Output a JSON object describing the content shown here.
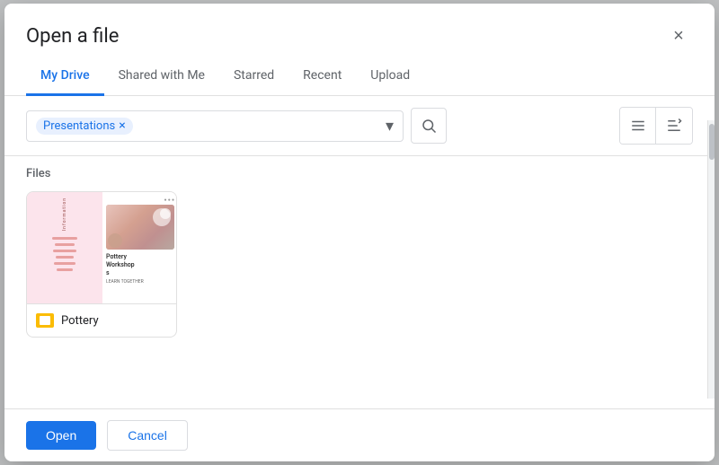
{
  "dialog": {
    "title": "Open a file",
    "close_label": "×"
  },
  "tabs": [
    {
      "id": "my-drive",
      "label": "My Drive",
      "active": true
    },
    {
      "id": "shared",
      "label": "Shared with Me",
      "active": false
    },
    {
      "id": "starred",
      "label": "Starred",
      "active": false
    },
    {
      "id": "recent",
      "label": "Recent",
      "active": false
    },
    {
      "id": "upload",
      "label": "Upload",
      "active": false
    }
  ],
  "toolbar": {
    "filter_chip_label": "Presentations",
    "filter_chip_remove": "×",
    "search_icon": "🔍",
    "list_view_icon": "☰",
    "sort_icon": "A↕"
  },
  "files_section": {
    "label": "Files",
    "items": [
      {
        "id": "pottery",
        "name": "Pottery",
        "type": "slides"
      }
    ]
  },
  "footer": {
    "open_label": "Open",
    "cancel_label": "Cancel"
  }
}
